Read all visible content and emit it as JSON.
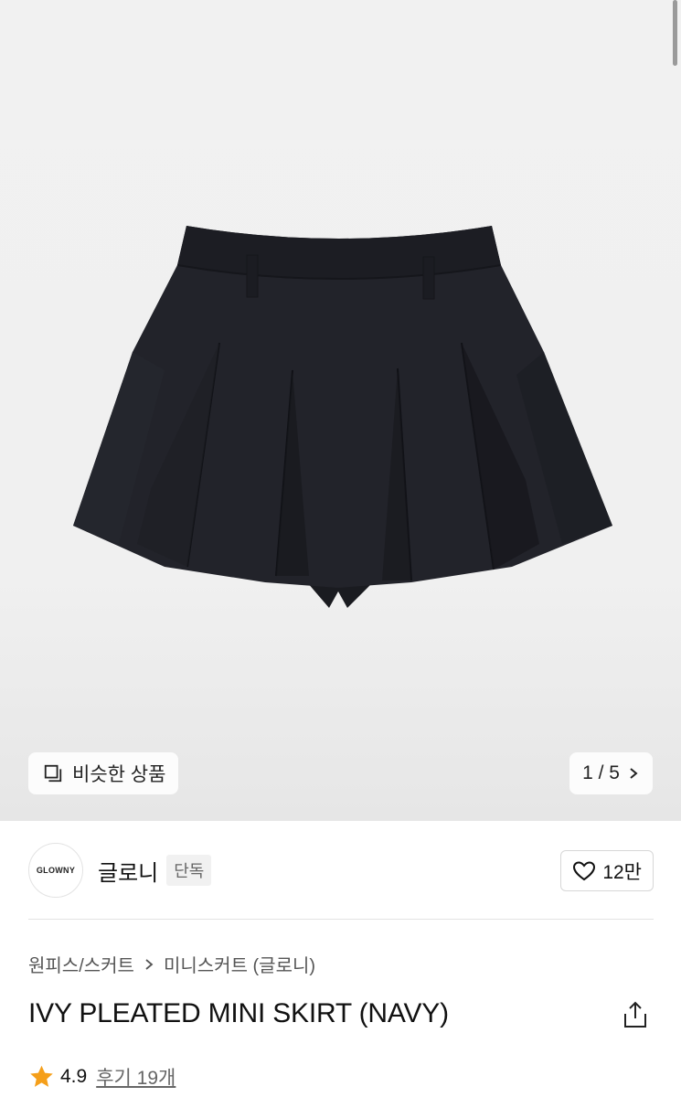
{
  "gallery": {
    "similar_label": "비슷한 상품",
    "counter": "1 / 5"
  },
  "brand": {
    "logo_text": "GLOWNY",
    "name": "글로니",
    "badge": "단독",
    "likes": "12만"
  },
  "breadcrumb": {
    "category": "원피스/스커트",
    "subcategory": "미니스커트 (글로니)"
  },
  "product": {
    "title": "IVY PLEATED MINI SKIRT (NAVY)"
  },
  "rating": {
    "score": "4.9",
    "reviews": "후기 19개",
    "star_color": "#f59f1a"
  }
}
